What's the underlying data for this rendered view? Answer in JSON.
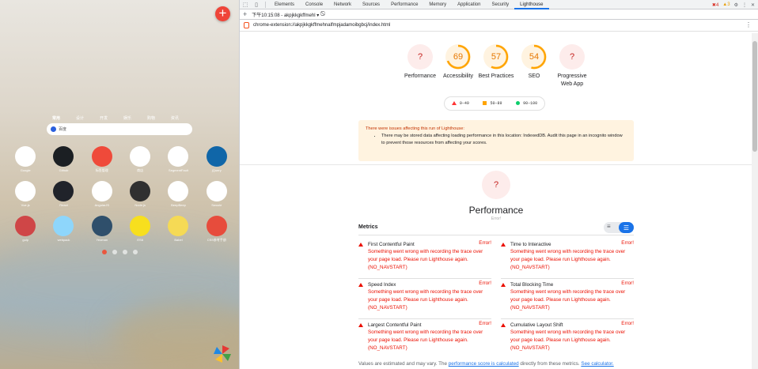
{
  "ntp": {
    "categories": [
      "常用",
      "设计",
      "开发",
      "娱乐",
      "购物",
      "资讯"
    ],
    "search_placeholder": "百度",
    "apps": [
      {
        "name": "Google",
        "label": "Google",
        "bg": "#ffffff",
        "fg": "#4285f4"
      },
      {
        "name": "github",
        "label": "Github",
        "bg": "#1b1f23",
        "fg": "#ffffff"
      },
      {
        "name": "tags",
        "label": "标签管理",
        "bg": "#ef4a3a",
        "fg": "#ffffff"
      },
      {
        "name": "shop",
        "label": "商店",
        "bg": "#ffffff",
        "fg": "#2f7de1"
      },
      {
        "name": "segmentfault",
        "label": "SegmentFault",
        "bg": "#ffffff",
        "fg": "#009a61"
      },
      {
        "name": "jquery",
        "label": "jQuery",
        "bg": "#1066a8",
        "fg": "#ffffff"
      },
      {
        "name": "vue",
        "label": "Vue.js",
        "bg": "#ffffff",
        "fg": "#41b883"
      },
      {
        "name": "react",
        "label": "React",
        "bg": "#20232a",
        "fg": "#61dafb"
      },
      {
        "name": "angular",
        "label": "AngularJS",
        "bg": "#ffffff",
        "fg": "#dd0031"
      },
      {
        "name": "node",
        "label": "Node.js",
        "bg": "#303030",
        "fg": "#ffffff"
      },
      {
        "name": "target",
        "label": "BeepBeep",
        "bg": "#ffffff",
        "fg": "#e53935"
      },
      {
        "name": "tiger",
        "label": "Swoole",
        "bg": "#ffffff",
        "fg": "#d98b1d"
      },
      {
        "name": "gulp",
        "label": "gulp",
        "bg": "#cf4647",
        "fg": "#ffffff"
      },
      {
        "name": "webpack",
        "label": "webpack",
        "bg": "#8ed6fb",
        "fg": "#1c78c0"
      },
      {
        "name": "wizard",
        "label": "Yeoman",
        "bg": "#2f4f6b",
        "fg": "#ffffff"
      },
      {
        "name": "es6",
        "label": "ES6",
        "bg": "#f7df1e",
        "fg": "#000000"
      },
      {
        "name": "babel",
        "label": "Babel",
        "bg": "#f5da55",
        "fg": "#323330"
      },
      {
        "name": "cn",
        "label": "CSS参考手册",
        "bg": "#e74c3c",
        "fg": "#ffffff"
      }
    ]
  },
  "devtools": {
    "tabs": [
      "Elements",
      "Console",
      "Network",
      "Sources",
      "Performance",
      "Memory",
      "Application",
      "Security",
      "Lighthouse"
    ],
    "active_tab": "Lighthouse",
    "errors_count": "4",
    "warnings_count": "3",
    "report_selector": "下午10:15:08 - akpjkkgkffmehl",
    "url": "chrome-extension://akpjkkgkffmehnalfmpjadamoibgbcj/index.html",
    "gauges": [
      {
        "label": "Performance",
        "value": "?",
        "kind": "error"
      },
      {
        "label": "Accessibility",
        "value": "69",
        "kind": "average",
        "score": 0.69
      },
      {
        "label": "Best Practices",
        "value": "57",
        "kind": "average",
        "score": 0.57
      },
      {
        "label": "SEO",
        "value": "54",
        "kind": "average",
        "score": 0.54
      },
      {
        "label": "Progressive Web App",
        "value": "?",
        "kind": "error"
      }
    ],
    "legend": [
      "0–49",
      "50–89",
      "90–100"
    ],
    "warning": {
      "title": "There were issues affecting this run of Lighthouse:",
      "item": "There may be stored data affecting loading performance in this location: IndexedDB. Audit this page in an incognito window to prevent those resources from affecting your scores."
    },
    "performance": {
      "value": "?",
      "title": "Performance",
      "subtitle": "Error!"
    },
    "metrics_heading": "Metrics",
    "metrics": [
      {
        "name": "First Contentful Paint",
        "status": "Error!",
        "message": "Something went wrong with recording the trace over your page load. Please run Lighthouse again. (NO_NAVSTART)"
      },
      {
        "name": "Time to Interactive",
        "status": "Error!",
        "message": "Something went wrong with recording the trace over your page load. Please run Lighthouse again. (NO_NAVSTART)"
      },
      {
        "name": "Speed Index",
        "status": "Error!",
        "message": "Something went wrong with recording the trace over your page load. Please run Lighthouse again. (NO_NAVSTART)"
      },
      {
        "name": "Total Blocking Time",
        "status": "Error!",
        "message": "Something went wrong with recording the trace over your page load. Please run Lighthouse again. (NO_NAVSTART)"
      },
      {
        "name": "Largest Contentful Paint",
        "status": "Error!",
        "message": "Something went wrong with recording the trace over your page load. Please run Lighthouse again. (NO_NAVSTART)"
      },
      {
        "name": "Cumulative Layout Shift",
        "status": "Error!",
        "message": "Something went wrong with recording the trace over your page load. Please run Lighthouse again. (NO_NAVSTART)"
      }
    ],
    "footer": {
      "pre": "Values are estimated and may vary. The ",
      "link1": "performance score is calculated",
      "mid": " directly from these metrics. ",
      "link2": "See calculator."
    }
  }
}
